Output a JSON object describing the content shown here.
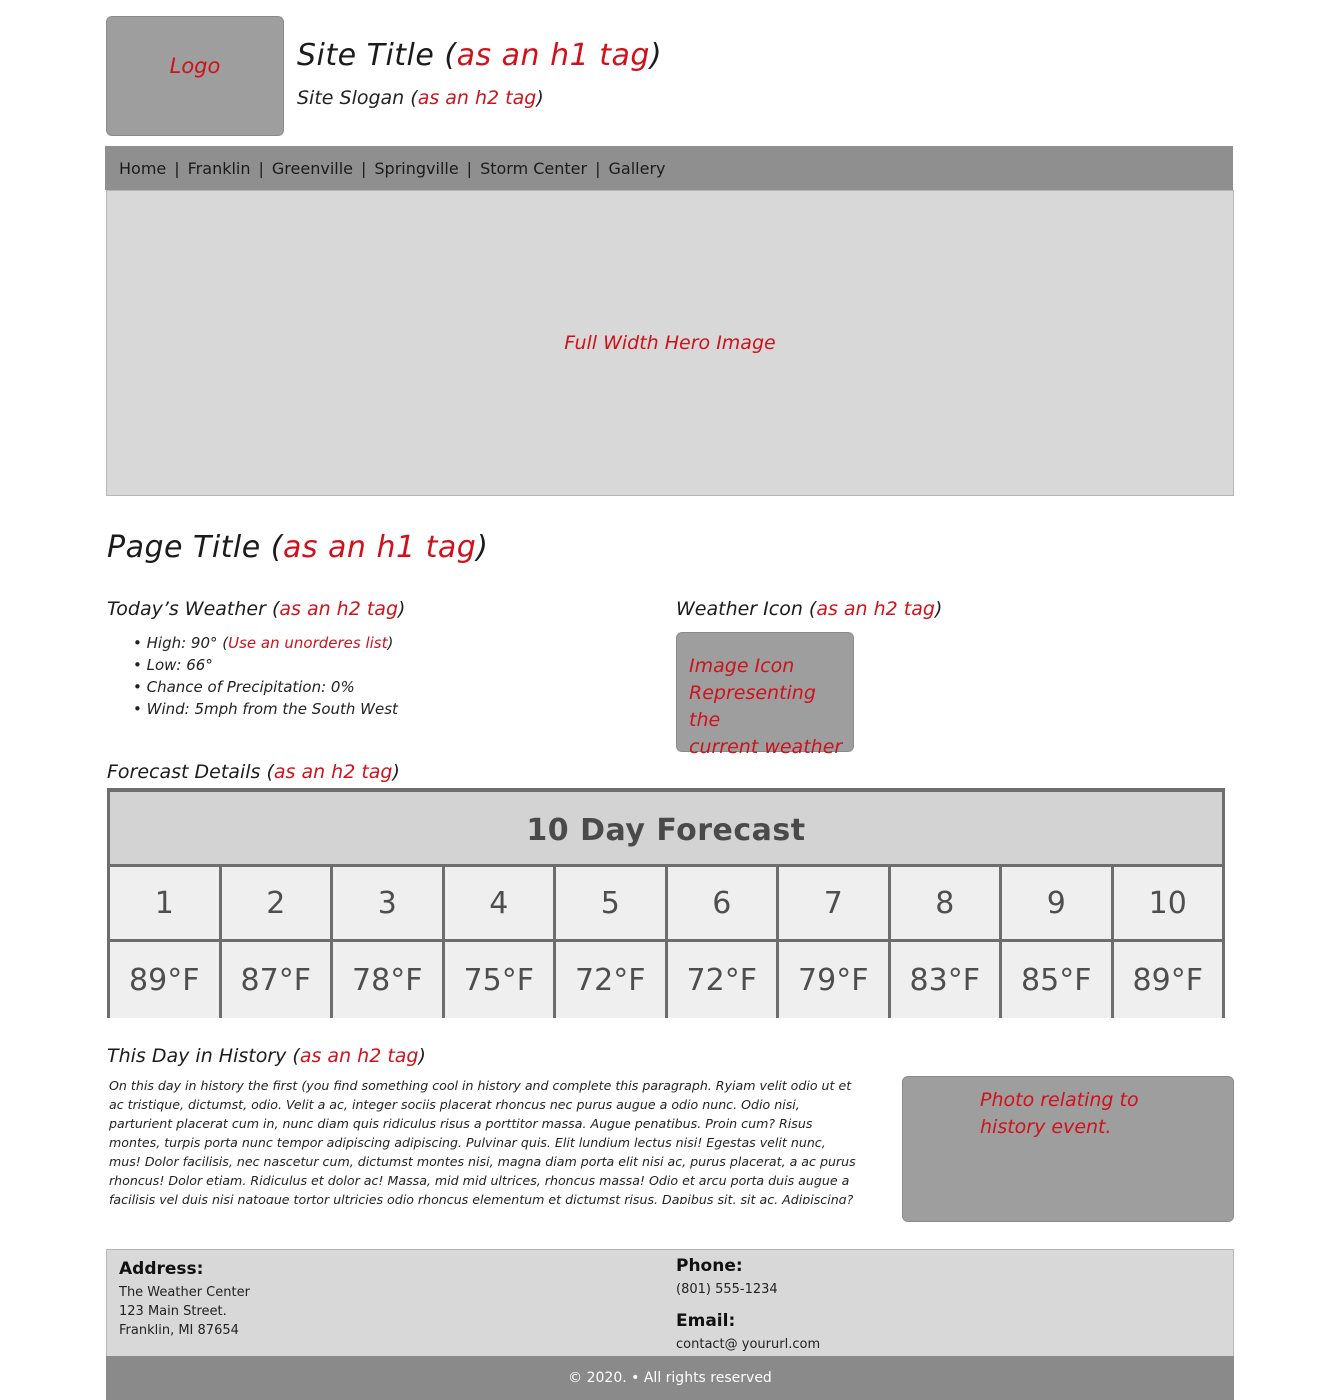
{
  "header": {
    "logo": "Logo",
    "site_title": "Site Title (",
    "site_title_note": "as an h1 tag",
    "site_title_close": ")",
    "slogan": "Site Slogan (",
    "slogan_note": "as an h2 tag",
    "slogan_close": ")"
  },
  "nav": {
    "items": [
      "Home",
      "Franklin",
      "Greenville",
      "Springville",
      "Storm Center",
      "Gallery"
    ],
    "separator": "|"
  },
  "hero": {
    "label": "Full Width Hero Image"
  },
  "page_title": {
    "text": "Page Title (",
    "note": "as an h1 tag",
    "close": ")"
  },
  "weather": {
    "heading": "Today’s Weather (",
    "heading_note": "as an h2 tag",
    "heading_close": ")",
    "list": [
      {
        "text": "• High: 90° (",
        "note": "Use an unorderes list",
        "close": ")"
      },
      {
        "text": "• Low: 66°"
      },
      {
        "text": "• Chance of Precipitation: 0%"
      },
      {
        "text": "• Wind: 5mph from the South West"
      }
    ]
  },
  "weather_icon": {
    "heading": "Weather Icon (",
    "heading_note": "as an h2 tag",
    "heading_close": ")",
    "box_lines": [
      "Image Icon",
      "Representing the",
      "current weather"
    ]
  },
  "forecast": {
    "heading": "Forecast Details (",
    "heading_note": "as an h2 tag",
    "heading_close": ")",
    "table_title": "10 Day Forecast",
    "days": [
      "1",
      "2",
      "3",
      "4",
      "5",
      "6",
      "7",
      "8",
      "9",
      "10"
    ],
    "temps": [
      "89°F",
      "87°F",
      "78°F",
      "75°F",
      "72°F",
      "72°F",
      "79°F",
      "83°F",
      "85°F",
      "89°F"
    ]
  },
  "history": {
    "heading": "This Day in History (",
    "heading_note": "as an h2 tag",
    "heading_close": ")",
    "paragraph": "On this day in history the first (you find something cool in history and complete this paragraph. Ryiam velit odio ut et ac tristique, dictumst, odio. Velit a ac, integer sociis placerat rhoncus nec purus augue a odio nunc. Odio nisi, parturient placerat cum in, nunc diam quis ridiculus risus a porttitor massa. Augue penatibus. Proin cum? Risus montes, turpis porta nunc tempor adipiscing adipiscing. Pulvinar quis. Elit lundium lectus nisi! Egestas velit nunc, mus! Dolor facilisis, nec nascetur cum, dictumst montes nisi, magna diam porta elit nisi ac, purus placerat, a ac purus rhoncus! Dolor etiam. Ridiculus et dolor ac! Massa, mid mid ultrices, rhoncus massa! Odio et arcu porta duis augue a facilisis vel duis nisi natoque tortor ultricies odio rhoncus elementum et dictumst risus. Dapibus sit, sit ac. Adipiscing?",
    "photo_lines": [
      "Photo relating to",
      "history event."
    ]
  },
  "footer": {
    "address_label": "Address:",
    "address_lines": [
      "The Weather Center",
      "123 Main Street.",
      "Franklin, MI 87654"
    ],
    "phone_label": "Phone:",
    "phone": "(801) 555-1234",
    "email_label": "Email:",
    "email": "contact@ yoururl.com",
    "copyright": "© 2020. • All rights reserved"
  }
}
